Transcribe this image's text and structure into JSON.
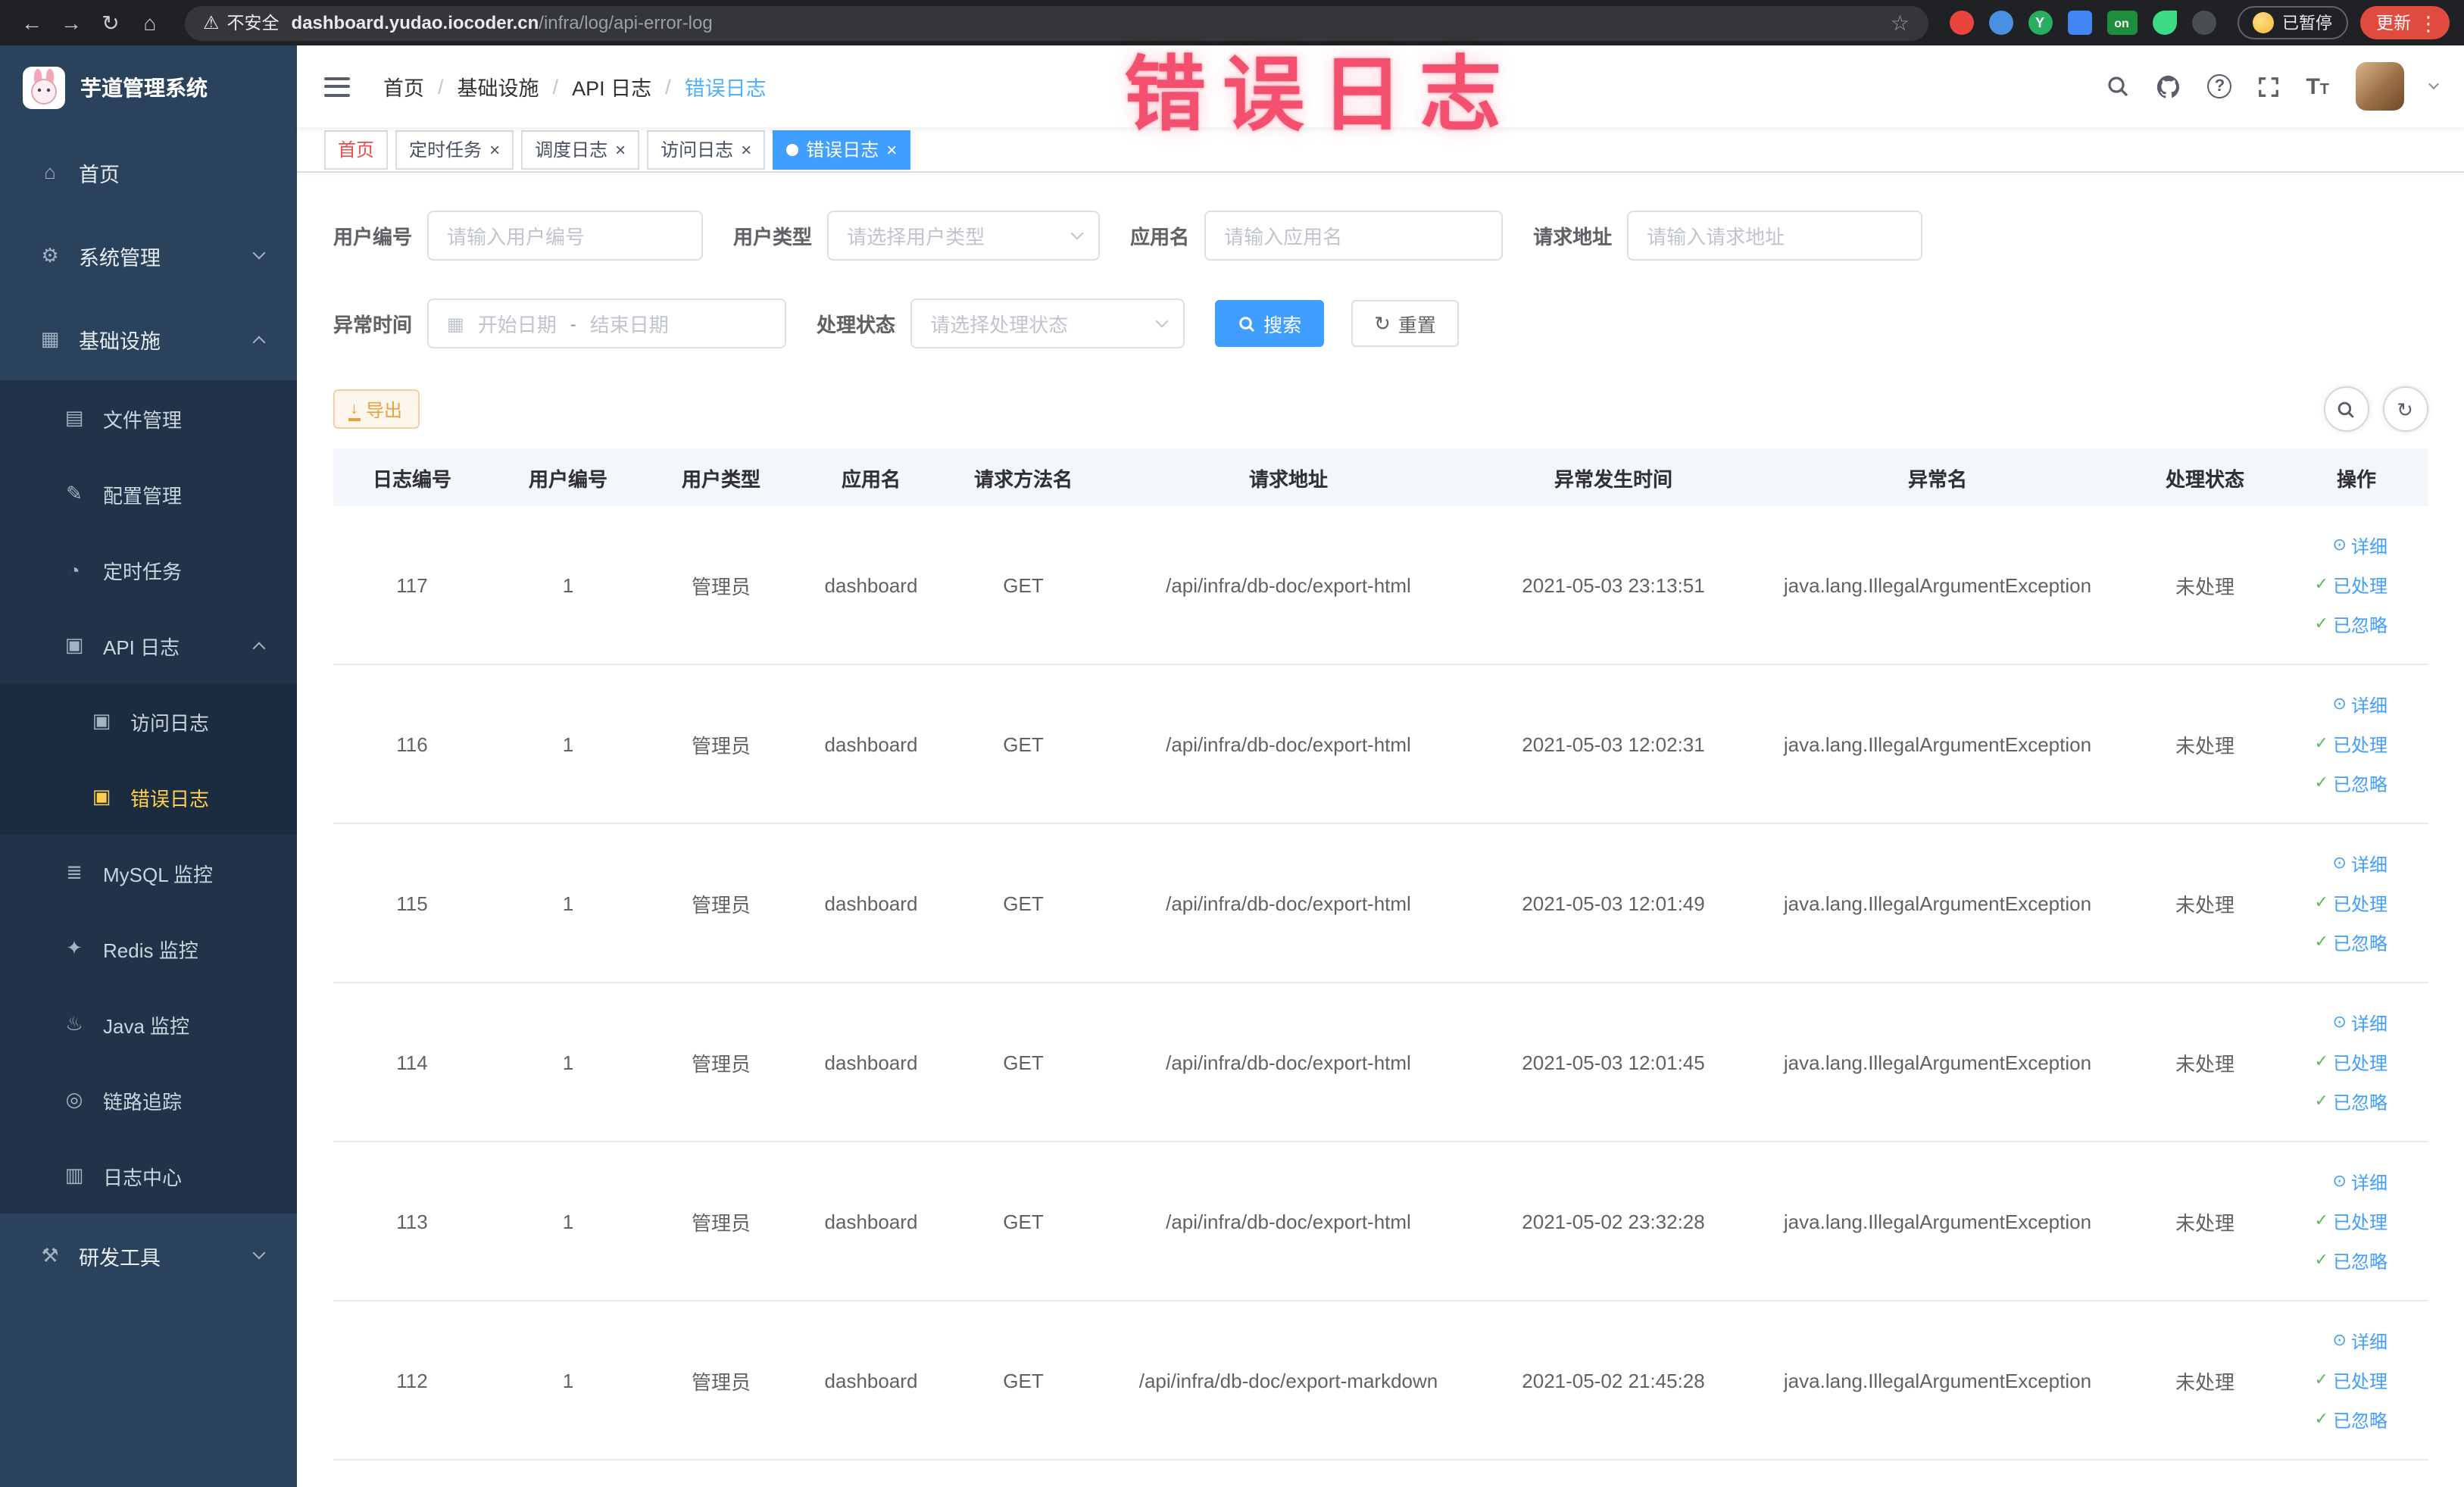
{
  "browser": {
    "security_label": "不安全",
    "url_domain": "dashboard.yudao.iocoder.cn",
    "url_path": "/infra/log/api-error-log",
    "extension_y_label": "Y",
    "extension_on_label": "on",
    "paused_label": "已暂停",
    "update_label": "更新"
  },
  "annotation": {
    "text": "错误日志",
    "color": "#f2506e"
  },
  "colors": {
    "accent": "#409eff",
    "sidebar_bg": "#2b425c",
    "sidebar_active": "#ffd04b",
    "warning_button": "#e6a23c",
    "tab_active_bg": "#409eff"
  },
  "sidebar": {
    "title": "芋道管理系统",
    "items": [
      {
        "id": "home",
        "label": "首页",
        "level": 1,
        "icon": "home-icon"
      },
      {
        "id": "system-management",
        "label": "系统管理",
        "level": 1,
        "icon": "gear-icon",
        "arrow": "down"
      },
      {
        "id": "infrastructure",
        "label": "基础设施",
        "level": 1,
        "icon": "grid-icon",
        "arrow": "up"
      },
      {
        "id": "file-management",
        "label": "文件管理",
        "level": 2,
        "icon": "folder-icon"
      },
      {
        "id": "config-management",
        "label": "配置管理",
        "level": 2,
        "icon": "edit-icon"
      },
      {
        "id": "scheduled-tasks",
        "label": "定时任务",
        "level": 2,
        "icon": "clock-icon"
      },
      {
        "id": "api-logs",
        "label": "API 日志",
        "level": 2,
        "icon": "doc-edit-icon",
        "arrow": "up"
      },
      {
        "id": "access-logs",
        "label": "访问日志",
        "level": 3,
        "icon": "doc-edit-icon"
      },
      {
        "id": "error-logs",
        "label": "错误日志",
        "level": 3,
        "icon": "doc-edit-icon",
        "active": true
      },
      {
        "id": "mysql-monitor",
        "label": "MySQL 监控",
        "level": 2,
        "icon": "database-icon"
      },
      {
        "id": "redis-monitor",
        "label": "Redis 监控",
        "level": 2,
        "icon": "redis-icon"
      },
      {
        "id": "java-monitor",
        "label": "Java 监控",
        "level": 2,
        "icon": "java-icon"
      },
      {
        "id": "link-trace",
        "label": "链路追踪",
        "level": 2,
        "icon": "trace-icon"
      },
      {
        "id": "log-center",
        "label": "日志中心",
        "level": 2,
        "icon": "log-icon"
      },
      {
        "id": "dev-tools",
        "label": "研发工具",
        "level": 1,
        "icon": "tools-icon",
        "arrow": "down"
      }
    ]
  },
  "header": {
    "breadcrumb": [
      "首页",
      "基础设施",
      "API 日志",
      "错误日志"
    ]
  },
  "tabs": [
    {
      "id": "home",
      "label": "首页",
      "closable": false,
      "active": false,
      "highlight": true
    },
    {
      "id": "scheduled-tasks",
      "label": "定时任务",
      "closable": true,
      "active": false
    },
    {
      "id": "schedule-logs",
      "label": "调度日志",
      "closable": true,
      "active": false
    },
    {
      "id": "access-logs",
      "label": "访问日志",
      "closable": true,
      "active": false
    },
    {
      "id": "error-logs",
      "label": "错误日志",
      "closable": true,
      "active": true
    }
  ],
  "filters": {
    "user_id_label": "用户编号",
    "user_id_placeholder": "请输入用户编号",
    "user_type_label": "用户类型",
    "user_type_placeholder": "请选择用户类型",
    "app_name_label": "应用名",
    "app_name_placeholder": "请输入应用名",
    "request_url_label": "请求地址",
    "request_url_placeholder": "请输入请求地址",
    "exception_time_label": "异常时间",
    "start_placeholder": "开始日期",
    "range_separator": "-",
    "end_placeholder": "结束日期",
    "process_status_label": "处理状态",
    "process_status_placeholder": "请选择处理状态",
    "search_label": "搜索",
    "reset_label": "重置"
  },
  "toolbar": {
    "export_label": "导出"
  },
  "table": {
    "headers": [
      "日志编号",
      "用户编号",
      "用户类型",
      "应用名",
      "请求方法名",
      "请求地址",
      "异常发生时间",
      "异常名",
      "处理状态",
      "操作"
    ],
    "column_keys": [
      "id",
      "user_id",
      "user_type",
      "app_name",
      "method",
      "url",
      "time",
      "exception",
      "status",
      "actions"
    ],
    "actions": [
      {
        "id": "detail",
        "label": "详细",
        "icon": "eye-icon"
      },
      {
        "id": "processed",
        "label": "已处理",
        "icon": "check-icon"
      },
      {
        "id": "ignored",
        "label": "已忽略",
        "icon": "check-icon"
      }
    ],
    "rows": [
      {
        "id": "117",
        "user_id": "1",
        "user_type": "管理员",
        "app_name": "dashboard",
        "method": "GET",
        "url": "/api/infra/db-doc/export-html",
        "time": "2021-05-03 23:13:51",
        "exception": "java.lang.IllegalArgumentException",
        "status": "未处理"
      },
      {
        "id": "116",
        "user_id": "1",
        "user_type": "管理员",
        "app_name": "dashboard",
        "method": "GET",
        "url": "/api/infra/db-doc/export-html",
        "time": "2021-05-03 12:02:31",
        "exception": "java.lang.IllegalArgumentException",
        "status": "未处理"
      },
      {
        "id": "115",
        "user_id": "1",
        "user_type": "管理员",
        "app_name": "dashboard",
        "method": "GET",
        "url": "/api/infra/db-doc/export-html",
        "time": "2021-05-03 12:01:49",
        "exception": "java.lang.IllegalArgumentException",
        "status": "未处理"
      },
      {
        "id": "114",
        "user_id": "1",
        "user_type": "管理员",
        "app_name": "dashboard",
        "method": "GET",
        "url": "/api/infra/db-doc/export-html",
        "time": "2021-05-03 12:01:45",
        "exception": "java.lang.IllegalArgumentException",
        "status": "未处理"
      },
      {
        "id": "113",
        "user_id": "1",
        "user_type": "管理员",
        "app_name": "dashboard",
        "method": "GET",
        "url": "/api/infra/db-doc/export-html",
        "time": "2021-05-02 23:32:28",
        "exception": "java.lang.IllegalArgumentException",
        "status": "未处理"
      },
      {
        "id": "112",
        "user_id": "1",
        "user_type": "管理员",
        "app_name": "dashboard",
        "method": "GET",
        "url": "/api/infra/db-doc/export-markdown",
        "time": "2021-05-02 21:45:28",
        "exception": "java.lang.IllegalArgumentException",
        "status": "未处理"
      }
    ]
  },
  "icon_glyphs": {
    "home-icon": "⌂",
    "gear-icon": "⚙",
    "grid-icon": "▦",
    "folder-icon": "▤",
    "edit-icon": "✎",
    "clock-icon": "◔",
    "doc-edit-icon": "▣",
    "database-icon": "≣",
    "redis-icon": "✦",
    "java-icon": "♨",
    "trace-icon": "◎",
    "log-icon": "▥",
    "tools-icon": "⚒",
    "eye-icon": "⊙",
    "check-icon": "✓"
  }
}
